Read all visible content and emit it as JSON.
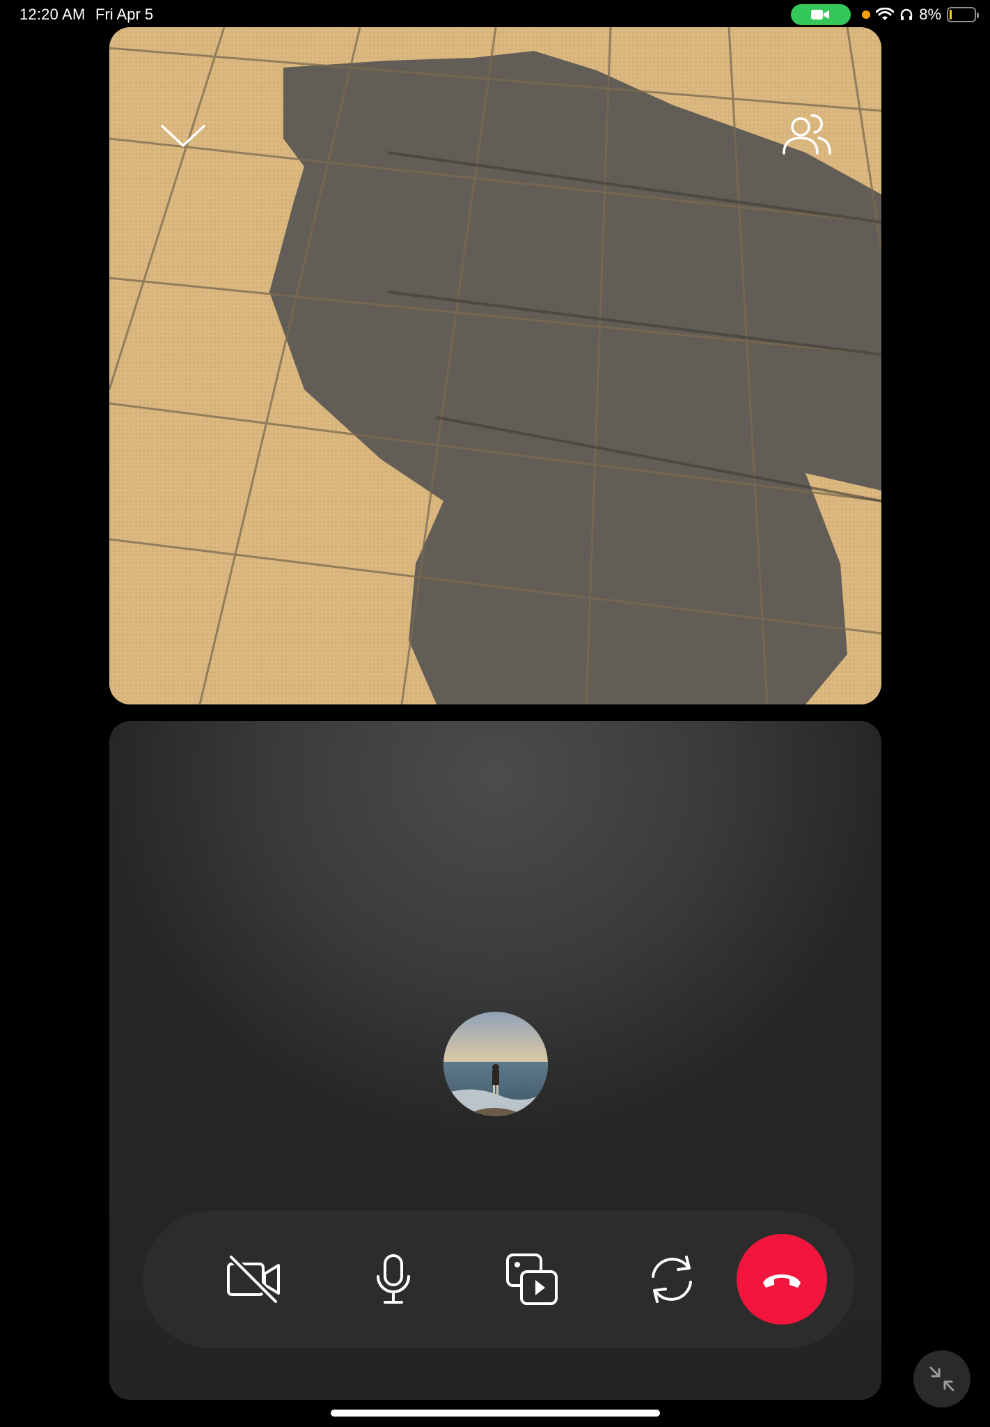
{
  "status_bar": {
    "time": "12:20 AM",
    "date": "Fri Apr 5",
    "battery": "8%",
    "battery_level": 0.08,
    "icons": [
      "camera-call-pill-icon",
      "mic-indicator-dot",
      "wifi-icon",
      "headphones-icon",
      "battery-icon"
    ],
    "call_pill_color": "#35c759",
    "indicator_dot_color": "#ff9f0a"
  },
  "remote_video": {
    "description_icons": [
      "chevron-down-icon",
      "participants-icon"
    ]
  },
  "self_tile": {
    "avatar": "profile-avatar"
  },
  "controls": {
    "buttons": [
      "camera-off-icon",
      "microphone-icon",
      "media-share-icon",
      "flip-camera-icon",
      "end-call-icon"
    ],
    "end_call_color": "#f2163e"
  },
  "corner": {
    "icon": "minimize-icon"
  }
}
